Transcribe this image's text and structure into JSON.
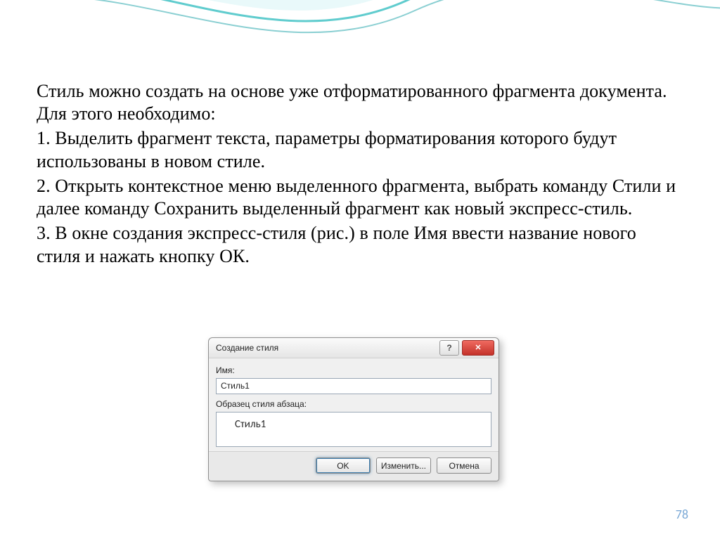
{
  "text": {
    "intro": "Стиль можно создать на основе уже отформатированного фрагмента документа. Для этого необходимо:",
    "step1": "1. Выделить фрагмент текста, параметры форматирования которого будут использованы в новом стиле.",
    "step2": "2. Открыть контекстное меню выделенного фрагмента, выбрать команду Стили и далее команду Сохранить выделенный фрагмент как новый экспресс-стиль.",
    "step3": "3. В окне создания экспресс-стиля (рис.) в поле Имя ввести название нового стиля и нажать кнопку ОК."
  },
  "dialog": {
    "title": "Создание стиля",
    "help_glyph": "?",
    "close_glyph": "✕",
    "name_label": "Имя:",
    "name_value": "Стиль1",
    "preview_label": "Образец стиля абзаца:",
    "preview_text": "Стиль1",
    "ok": "OK",
    "modify": "Изменить...",
    "cancel": "Отмена"
  },
  "page_number": "78"
}
